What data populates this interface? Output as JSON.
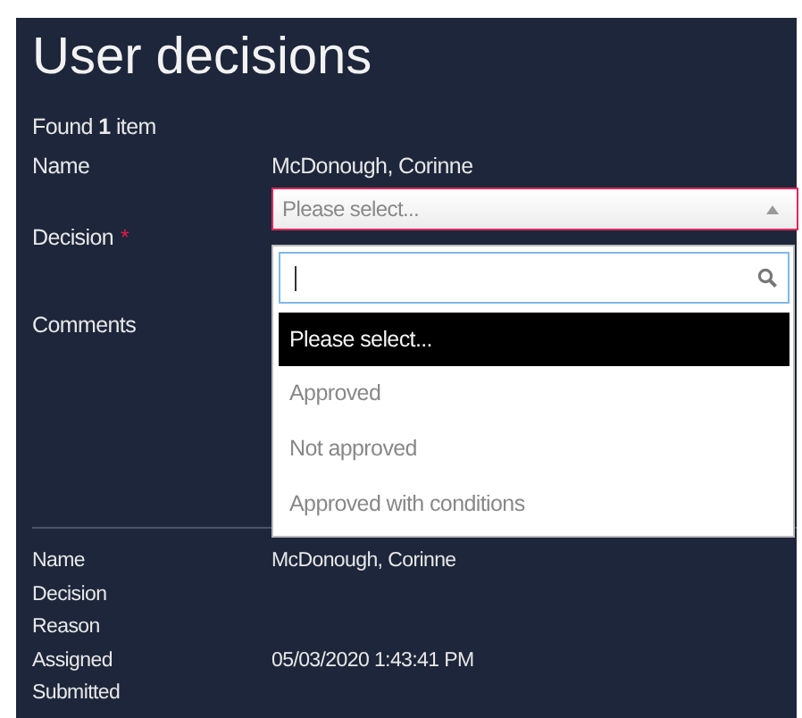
{
  "title": "User decisions",
  "result_count": "Found **1** item",
  "name": {
    "label": "Name",
    "value": "McDonough, Corinne"
  },
  "decision": {
    "label": "Decision",
    "required": true,
    "required_marker": "*",
    "placeholder": "Please select...",
    "expanded": true,
    "options": [
      {
        "label": "Please select...",
        "selected": true
      },
      {
        "label": "Approved",
        "selected": false
      },
      {
        "label": "Not approved",
        "selected": false
      },
      {
        "label": "Approved with conditions",
        "selected": false
      }
    ]
  },
  "comments": {
    "label": "Comments"
  },
  "details": [
    {
      "label": "Name",
      "value": "McDonough, Corinne"
    },
    {
      "label": "Decision"
    },
    {
      "label": "Reason"
    },
    {
      "label": "Assigned",
      "value": "05/03/2020 1:43:41 PM"
    },
    {
      "label": "Submitted"
    }
  ]
}
